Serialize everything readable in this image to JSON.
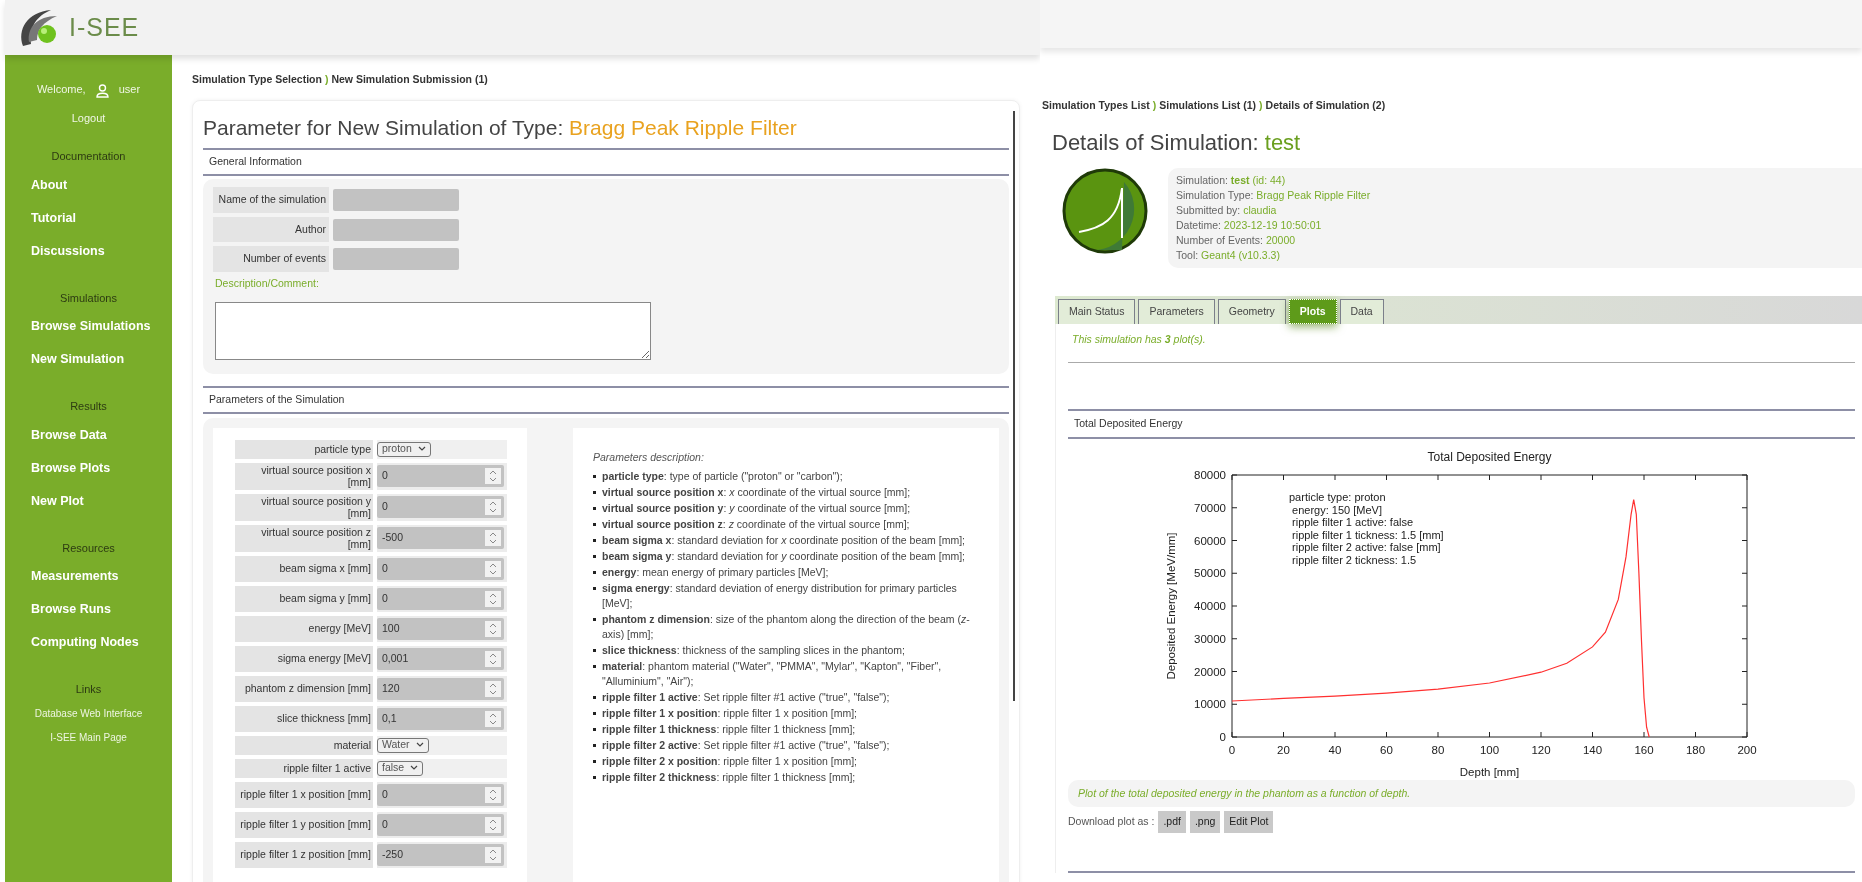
{
  "left_screen": {
    "logo_text": "I-SEE",
    "sidebar": {
      "welcome": "Welcome,",
      "user": "user",
      "logout": "Logout",
      "sections": [
        {
          "title": "Documentation",
          "kind": "large",
          "items": [
            "About",
            "Tutorial",
            "Discussions"
          ]
        },
        {
          "title": "Simulations",
          "kind": "large",
          "items": [
            "Browse Simulations",
            "New Simulation"
          ]
        },
        {
          "title": "Results",
          "kind": "large",
          "items": [
            "Browse Data",
            "Browse Plots",
            "New Plot"
          ]
        },
        {
          "title": "Resources",
          "kind": "large",
          "items": [
            "Measurements",
            "Browse Runs",
            "Computing Nodes"
          ]
        },
        {
          "title": "Links",
          "kind": "small",
          "items": [
            "Database Web Interface",
            "I-SEE Main Page"
          ]
        }
      ]
    },
    "breadcrumb": [
      {
        "kind": "link",
        "text": "Simulation Type Selection"
      },
      {
        "kind": "separator",
        "text": ")"
      },
      {
        "kind": "current",
        "text": "New Simulation Submission (1)"
      }
    ],
    "title_prefix": "Parameter for New Simulation of Type:",
    "title_type": "Bragg Peak Ripple Filter",
    "general_information": {
      "heading": "General Information",
      "fields": [
        {
          "label": "Name of the simulation"
        },
        {
          "label": "Author"
        },
        {
          "label": "Number of events"
        }
      ],
      "description_label": "Description/Comment:"
    },
    "parameters": {
      "heading": "Parameters of the Simulation",
      "rows": [
        {
          "label": "particle type",
          "kind": "select",
          "value": "proton"
        },
        {
          "label": "virtual source position x [mm]",
          "kind": "number",
          "value": "0"
        },
        {
          "label": "virtual source position y [mm]",
          "kind": "number",
          "value": "0"
        },
        {
          "label": "virtual source position z [mm]",
          "kind": "number",
          "value": "-500"
        },
        {
          "label": "beam sigma x [mm]",
          "kind": "number",
          "value": "0"
        },
        {
          "label": "beam sigma y [mm]",
          "kind": "number",
          "value": "0"
        },
        {
          "label": "energy [MeV]",
          "kind": "number",
          "value": "100"
        },
        {
          "label": "sigma energy [MeV]",
          "kind": "number",
          "value": "0,001"
        },
        {
          "label": "phantom z dimension [mm]",
          "kind": "number",
          "value": "120"
        },
        {
          "label": "slice thickness [mm]",
          "kind": "number",
          "value": "0,1"
        },
        {
          "label": "material",
          "kind": "select",
          "value": "Water"
        },
        {
          "label": "ripple filter 1 active",
          "kind": "select",
          "value": "false"
        },
        {
          "label": "ripple filter 1 x position [mm]",
          "kind": "number",
          "value": "0"
        },
        {
          "label": "ripple filter 1 y position [mm]",
          "kind": "number",
          "value": "0"
        },
        {
          "label": "ripple filter 1 z position [mm]",
          "kind": "number",
          "value": "-250"
        }
      ],
      "description_title": "Parameters description:",
      "descriptions": [
        "**particle type**: type of particle (\"proton\" or \"carbon\");",
        "**virtual source position x**: *x* coordinate of the virtual source [mm];",
        "**virtual source position y**: *y* coordinate of the virtual source [mm];",
        "**virtual source position z**: *z* coordinate of the virtual source [mm];",
        "**beam sigma x**: standard deviation for *x* coordinate position of the beam [mm];",
        "**beam sigma y**: standard deviation for *y* coordinate position of the beam [mm];",
        "**energy**: mean energy of primary particles [MeV];",
        "**sigma energy**: standard deviation of energy distribution for primary particles [MeV];",
        "**phantom z dimension**: size of the phantom along the direction of the beam (*z*-axis) [mm];",
        "**slice thickness**: thickness of the sampling slices in the phantom;",
        "**material**: phantom material (\"Water\", \"PMMA\", \"Mylar\", \"Kapton\", \"Fiber\", \"Alluminium\", \"Air\");",
        "**ripple filter 1 active**: Set ripple filter #1 active (\"true\", \"false\");",
        "**ripple filter 1 x position**: ripple filter 1 x position [mm];",
        "**ripple filter 1 thickness**: ripple filter 1 thickness [mm];",
        "**ripple filter 2 active**: Set ripple filter #1 active (\"true\", \"false\");",
        "**ripple filter 2 x position**: ripple filter 1 x position [mm];",
        "**ripple filter 2 thickness**: ripple filter 1 thickness [mm];"
      ]
    }
  },
  "right_screen": {
    "breadcrumb": [
      {
        "kind": "link",
        "text": "Simulation Types List"
      },
      {
        "kind": "separator",
        "text": ")"
      },
      {
        "kind": "link",
        "text": "Simulations List (1)"
      },
      {
        "kind": "separator",
        "text": ")"
      },
      {
        "kind": "current",
        "text": "Details of Simulation (2)"
      }
    ],
    "title_prefix": "Details of Simulation:",
    "title_name": "test",
    "info": [
      {
        "label": "Simulation:",
        "value": "**test** (id: 44)"
      },
      {
        "label": "Simulation Type:",
        "value": "Bragg Peak Ripple Filter"
      },
      {
        "label": "Submitted by:",
        "value": "claudia"
      },
      {
        "label": "Datetime:",
        "value": "2023-12-19 10:50:01"
      },
      {
        "label": "Number of Events:",
        "value": "20000"
      },
      {
        "label": "Tool:",
        "value": "Geant4 (v10.3.3)"
      }
    ],
    "tabs": [
      {
        "label": "Main Status",
        "selected": false
      },
      {
        "label": "Parameters",
        "selected": false
      },
      {
        "label": "Geometry",
        "selected": false
      },
      {
        "label": "Plots",
        "selected": true
      },
      {
        "label": "Data",
        "selected": false
      }
    ],
    "plot_count": "This simulation has **3** plot(s).",
    "plot": {
      "heading": "Total Deposited Energy",
      "chart_data": {
        "type": "line",
        "title": "Total Deposited Energy",
        "xlabel": "Depth [mm]",
        "ylabel": "Deposited Energy [MeV/mm]",
        "x": [
          0,
          20,
          40,
          60,
          80,
          100,
          120,
          130,
          140,
          145,
          150,
          153,
          155,
          156,
          157,
          158,
          159,
          160,
          161,
          162
        ],
        "series": [
          {
            "color": "#ff3030",
            "values": [
              11000,
              11800,
              12500,
              13400,
              14600,
              16500,
              19800,
              22500,
              27500,
              32000,
              42000,
              55000,
              68000,
              72500,
              68000,
              50000,
              30000,
              12000,
              3000,
              0
            ]
          }
        ],
        "xlim": [
          0,
          200
        ],
        "ylim": [
          0,
          80000
        ],
        "xticks": [
          0,
          20,
          40,
          60,
          80,
          100,
          120,
          140,
          160,
          180,
          200
        ],
        "yticks": [
          0,
          10000,
          20000,
          30000,
          40000,
          50000,
          60000,
          70000,
          80000
        ],
        "annotations": [
          "particle type: proton",
          " energy: 150 [MeV]",
          " ripple filter 1 active: false",
          " ripple filter 1 tickness: 1.5 [mm]",
          " ripple filter 2 active: false [mm]",
          " ripple filter 2 tickness: 1.5"
        ]
      },
      "caption": "Plot of the total deposited energy in the phantom as a function of depth.",
      "download_label": "Download plot as :",
      "buttons": [
        ".pdf",
        ".png",
        "Edit Plot"
      ]
    }
  }
}
